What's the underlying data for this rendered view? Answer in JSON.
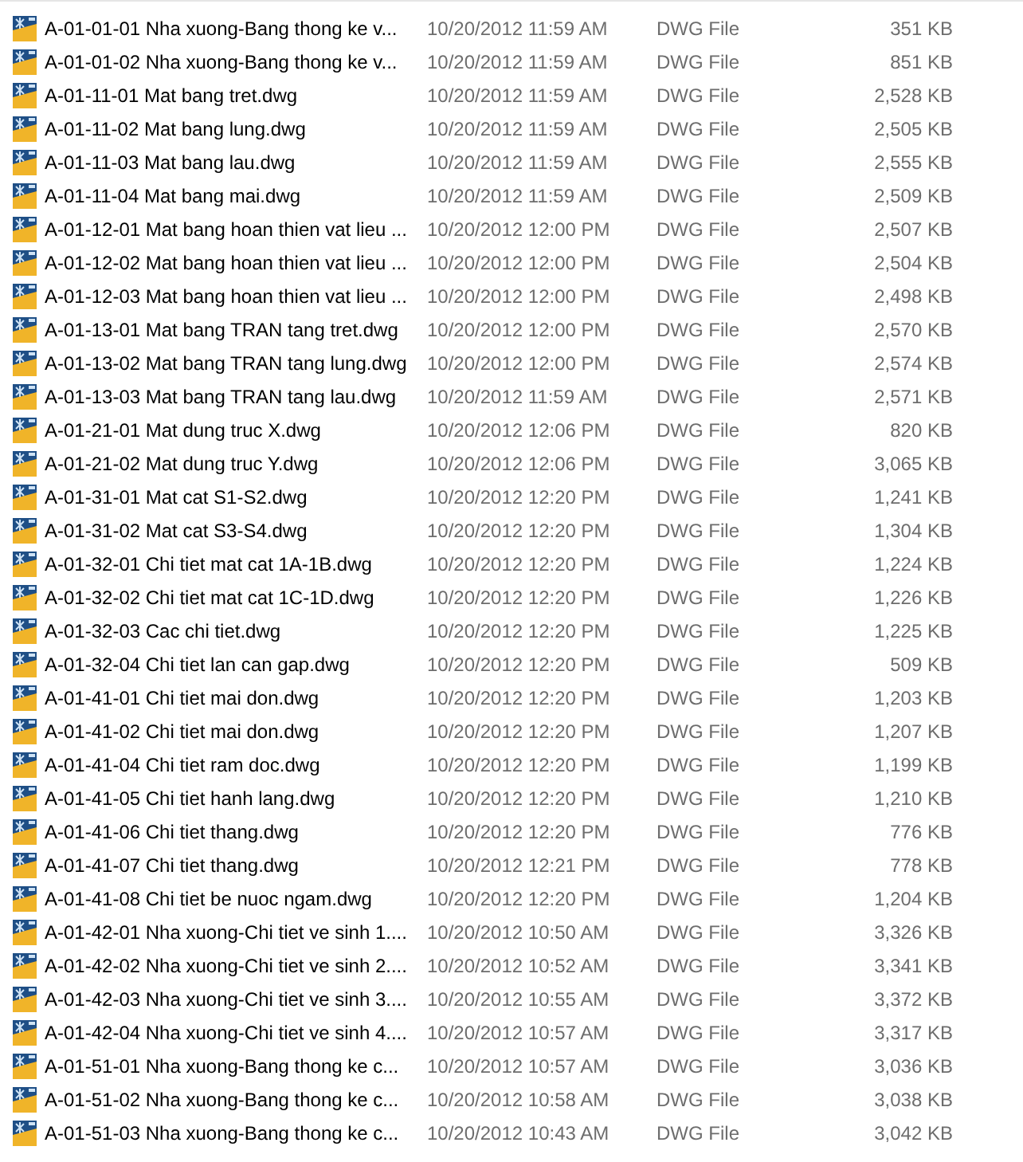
{
  "files": [
    {
      "name": "A-01-01-01 Nha xuong-Bang thong ke v...",
      "date": "10/20/2012 11:59 AM",
      "type": "DWG File",
      "size": "351 KB"
    },
    {
      "name": "A-01-01-02 Nha xuong-Bang thong ke v...",
      "date": "10/20/2012 11:59 AM",
      "type": "DWG File",
      "size": "851 KB"
    },
    {
      "name": "A-01-11-01 Mat bang tret.dwg",
      "date": "10/20/2012 11:59 AM",
      "type": "DWG File",
      "size": "2,528 KB"
    },
    {
      "name": "A-01-11-02 Mat bang lung.dwg",
      "date": "10/20/2012 11:59 AM",
      "type": "DWG File",
      "size": "2,505 KB"
    },
    {
      "name": "A-01-11-03 Mat bang lau.dwg",
      "date": "10/20/2012 11:59 AM",
      "type": "DWG File",
      "size": "2,555 KB"
    },
    {
      "name": "A-01-11-04 Mat bang mai.dwg",
      "date": "10/20/2012 11:59 AM",
      "type": "DWG File",
      "size": "2,509 KB"
    },
    {
      "name": "A-01-12-01 Mat bang hoan thien vat lieu ...",
      "date": "10/20/2012 12:00 PM",
      "type": "DWG File",
      "size": "2,507 KB"
    },
    {
      "name": "A-01-12-02 Mat bang hoan thien vat lieu ...",
      "date": "10/20/2012 12:00 PM",
      "type": "DWG File",
      "size": "2,504 KB"
    },
    {
      "name": "A-01-12-03 Mat bang hoan thien vat lieu ...",
      "date": "10/20/2012 12:00 PM",
      "type": "DWG File",
      "size": "2,498 KB"
    },
    {
      "name": "A-01-13-01 Mat bang TRAN tang tret.dwg",
      "date": "10/20/2012 12:00 PM",
      "type": "DWG File",
      "size": "2,570 KB"
    },
    {
      "name": "A-01-13-02 Mat bang TRAN tang lung.dwg",
      "date": "10/20/2012 12:00 PM",
      "type": "DWG File",
      "size": "2,574 KB"
    },
    {
      "name": "A-01-13-03 Mat bang TRAN tang lau.dwg",
      "date": "10/20/2012 11:59 AM",
      "type": "DWG File",
      "size": "2,571 KB"
    },
    {
      "name": "A-01-21-01 Mat dung truc X.dwg",
      "date": "10/20/2012 12:06 PM",
      "type": "DWG File",
      "size": "820 KB"
    },
    {
      "name": "A-01-21-02 Mat dung truc Y.dwg",
      "date": "10/20/2012 12:06 PM",
      "type": "DWG File",
      "size": "3,065 KB"
    },
    {
      "name": "A-01-31-01 Mat cat S1-S2.dwg",
      "date": "10/20/2012 12:20 PM",
      "type": "DWG File",
      "size": "1,241 KB"
    },
    {
      "name": "A-01-31-02 Mat cat S3-S4.dwg",
      "date": "10/20/2012 12:20 PM",
      "type": "DWG File",
      "size": "1,304 KB"
    },
    {
      "name": "A-01-32-01 Chi tiet mat cat 1A-1B.dwg",
      "date": "10/20/2012 12:20 PM",
      "type": "DWG File",
      "size": "1,224 KB"
    },
    {
      "name": "A-01-32-02 Chi tiet mat cat 1C-1D.dwg",
      "date": "10/20/2012 12:20 PM",
      "type": "DWG File",
      "size": "1,226 KB"
    },
    {
      "name": "A-01-32-03 Cac chi tiet.dwg",
      "date": "10/20/2012 12:20 PM",
      "type": "DWG File",
      "size": "1,225 KB"
    },
    {
      "name": "A-01-32-04 Chi tiet lan can gap.dwg",
      "date": "10/20/2012 12:20 PM",
      "type": "DWG File",
      "size": "509 KB"
    },
    {
      "name": "A-01-41-01 Chi tiet mai don.dwg",
      "date": "10/20/2012 12:20 PM",
      "type": "DWG File",
      "size": "1,203 KB"
    },
    {
      "name": "A-01-41-02 Chi tiet mai don.dwg",
      "date": "10/20/2012 12:20 PM",
      "type": "DWG File",
      "size": "1,207 KB"
    },
    {
      "name": "A-01-41-04 Chi tiet ram doc.dwg",
      "date": "10/20/2012 12:20 PM",
      "type": "DWG File",
      "size": "1,199 KB"
    },
    {
      "name": "A-01-41-05 Chi tiet hanh lang.dwg",
      "date": "10/20/2012 12:20 PM",
      "type": "DWG File",
      "size": "1,210 KB"
    },
    {
      "name": "A-01-41-06 Chi tiet thang.dwg",
      "date": "10/20/2012 12:20 PM",
      "type": "DWG File",
      "size": "776 KB"
    },
    {
      "name": "A-01-41-07 Chi tiet thang.dwg",
      "date": "10/20/2012 12:21 PM",
      "type": "DWG File",
      "size": "778 KB"
    },
    {
      "name": "A-01-41-08 Chi tiet be nuoc ngam.dwg",
      "date": "10/20/2012 12:20 PM",
      "type": "DWG File",
      "size": "1,204 KB"
    },
    {
      "name": "A-01-42-01 Nha xuong-Chi tiet ve sinh 1....",
      "date": "10/20/2012 10:50 AM",
      "type": "DWG File",
      "size": "3,326 KB"
    },
    {
      "name": "A-01-42-02 Nha xuong-Chi tiet ve sinh 2....",
      "date": "10/20/2012 10:52 AM",
      "type": "DWG File",
      "size": "3,341 KB"
    },
    {
      "name": "A-01-42-03 Nha xuong-Chi tiet ve sinh 3....",
      "date": "10/20/2012 10:55 AM",
      "type": "DWG File",
      "size": "3,372 KB"
    },
    {
      "name": "A-01-42-04 Nha xuong-Chi tiet ve sinh 4....",
      "date": "10/20/2012 10:57 AM",
      "type": "DWG File",
      "size": "3,317 KB"
    },
    {
      "name": "A-01-51-01 Nha xuong-Bang thong ke c...",
      "date": "10/20/2012 10:57 AM",
      "type": "DWG File",
      "size": "3,036 KB"
    },
    {
      "name": "A-01-51-02 Nha xuong-Bang thong ke c...",
      "date": "10/20/2012 10:58 AM",
      "type": "DWG File",
      "size": "3,038 KB"
    },
    {
      "name": "A-01-51-03 Nha xuong-Bang thong ke c...",
      "date": "10/20/2012 10:43 AM",
      "type": "DWG File",
      "size": "3,042 KB"
    }
  ]
}
